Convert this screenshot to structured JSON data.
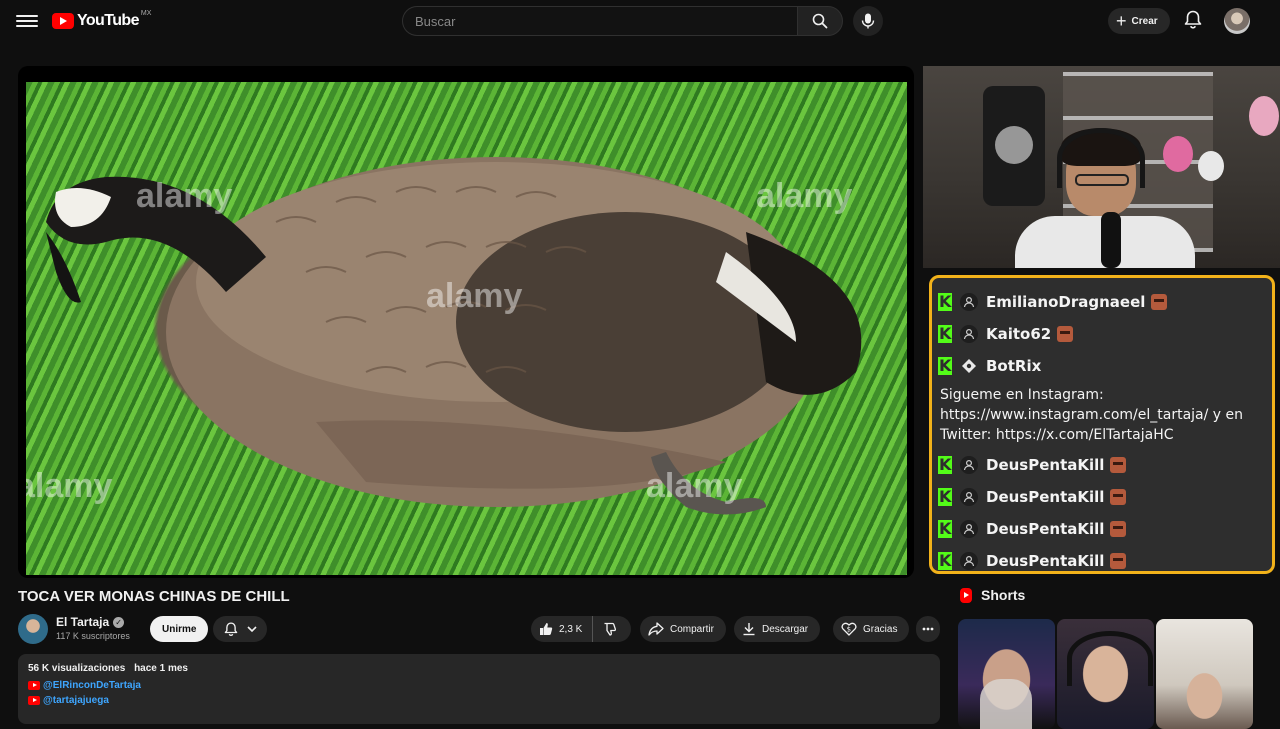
{
  "header": {
    "logo_text": "YouTube",
    "region": "MX",
    "search_placeholder": "Buscar",
    "create_label": "Crear"
  },
  "video": {
    "title": "TOCA VER MONAS CHINAS DE CHILL",
    "channel": {
      "name": "El Tartaja",
      "subscribers": "117 K suscriptores",
      "join_label": "Unirme"
    },
    "actions": {
      "likes": "2,3 K",
      "share": "Compartir",
      "download": "Descargar",
      "thanks": "Gracias"
    },
    "description": {
      "views": "56 K visualizaciones",
      "date": "hace 1 mes",
      "links": [
        "@ElRinconDeTartaja",
        "@tartajajuega"
      ]
    }
  },
  "stream_overlay": {
    "chat": [
      {
        "type": "user",
        "name": "EmilianoDragnaeel",
        "emote": true
      },
      {
        "type": "user",
        "name": "Kaito62",
        "emote": true
      },
      {
        "type": "user",
        "name": "BotRix",
        "emote": false,
        "bot": true
      },
      {
        "type": "message",
        "text": "Sigueme en Instagram: https://www.instagram.com/el_tartaja/ y en Twitter: https://x.com/ElTartajaHC"
      },
      {
        "type": "user",
        "name": "DeusPentaKill",
        "emote": true
      },
      {
        "type": "user",
        "name": "DeusPentaKill",
        "emote": true
      },
      {
        "type": "user",
        "name": "DeusPentaKill",
        "emote": true
      },
      {
        "type": "user",
        "name": "DeusPentaKill",
        "emote": true
      }
    ],
    "watermark": "alamy"
  },
  "shorts": {
    "header": "Shorts"
  },
  "colors": {
    "accent_red": "#ff0000",
    "chat_border": "#f2b21a",
    "kick_green": "#53fc18",
    "link_blue": "#3ea6ff"
  }
}
